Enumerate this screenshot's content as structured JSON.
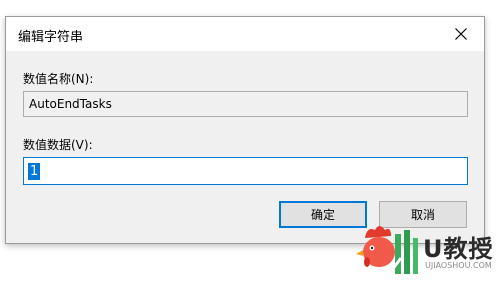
{
  "window": {
    "title": "编辑字符串",
    "close_icon": "close-icon"
  },
  "fields": {
    "name_label": "数值名称(N):",
    "name_value": "AutoEndTasks",
    "data_label": "数值数据(V):",
    "data_value": "1"
  },
  "buttons": {
    "ok_label": "确定",
    "cancel_label": "取消"
  },
  "watermark": {
    "brand": "U教授",
    "subtext": "UJIAOSHOU.COM",
    "logo_icon": "rooster-logo"
  },
  "colors": {
    "accent": "#0078d7",
    "dialog_bg": "#f0f0f0",
    "button_bg": "#e1e1e1"
  }
}
